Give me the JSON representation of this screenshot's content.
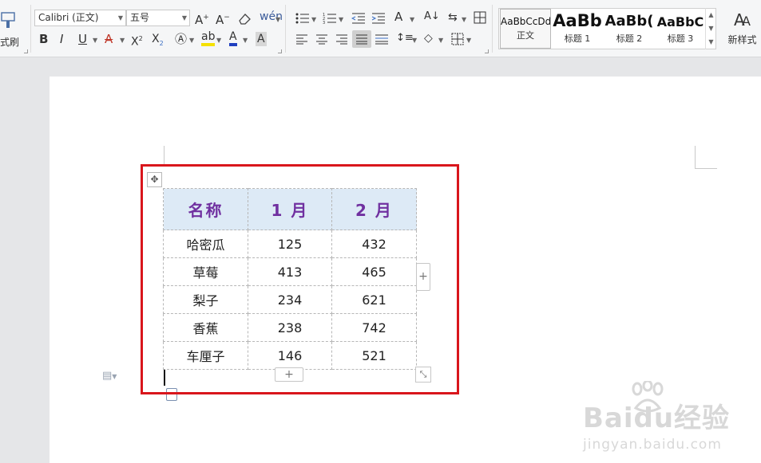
{
  "ribbon": {
    "format_painter_label": "格式刷",
    "font_name": "Calibri (正文)",
    "font_size": "五号",
    "style_gallery": [
      {
        "sample": "AaBbCcDd",
        "name": "正文",
        "selected": true
      },
      {
        "sample": "AaBb",
        "name": "标题 1",
        "selected": false
      },
      {
        "sample": "AaBb(",
        "name": "标题 2",
        "selected": false
      },
      {
        "sample": "AaBbC",
        "name": "标题 3",
        "selected": false
      }
    ],
    "new_style_label": "新样式"
  },
  "table": {
    "headers": [
      "名称",
      "1 月",
      "2 月"
    ],
    "rows": [
      [
        "哈密瓜",
        "125",
        "432"
      ],
      [
        "草莓",
        "413",
        "465"
      ],
      [
        "梨子",
        "234",
        "621"
      ],
      [
        "香蕉",
        "238",
        "742"
      ],
      [
        "车厘子",
        "146",
        "521"
      ]
    ]
  },
  "watermark": {
    "main": "Baidu经验",
    "sub": "jingyan.baidu.com"
  },
  "colors": {
    "header_bg": "#ddeaf6",
    "header_text": "#7030a0",
    "highlight": "#d9161c"
  }
}
